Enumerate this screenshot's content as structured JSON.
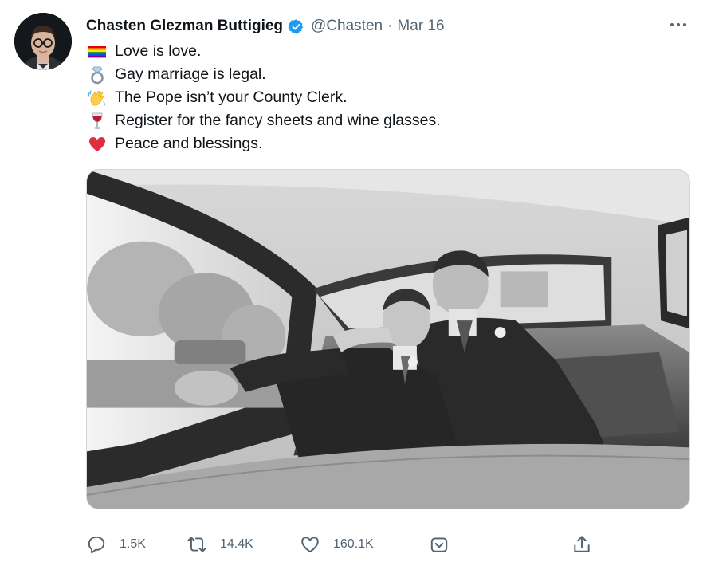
{
  "tweet": {
    "author_name": "Chasten Glezman Buttigieg",
    "handle": "@Chasten",
    "separator": "·",
    "date": "Mar 16",
    "lines": [
      {
        "emoji": "rainbow-flag-icon",
        "text": "Love is love."
      },
      {
        "emoji": "ring-icon",
        "text": "Gay marriage is legal."
      },
      {
        "emoji": "waving-hand-icon",
        "text": "The Pope isn’t your County Clerk."
      },
      {
        "emoji": "wine-glass-icon",
        "text": "Register for the fancy sheets and wine glasses."
      },
      {
        "emoji": "red-heart-icon",
        "text": "Peace and blessings."
      }
    ],
    "photo_icon": "wedding-car-photo"
  },
  "actions": {
    "reply_count": "1.5K",
    "retweet_count": "14.4K",
    "like_count": "160.1K"
  },
  "colors": {
    "text_primary": "#0f1419",
    "text_secondary": "#536471",
    "verified_blue": "#1d9bf0",
    "border": "#cfd9de"
  }
}
